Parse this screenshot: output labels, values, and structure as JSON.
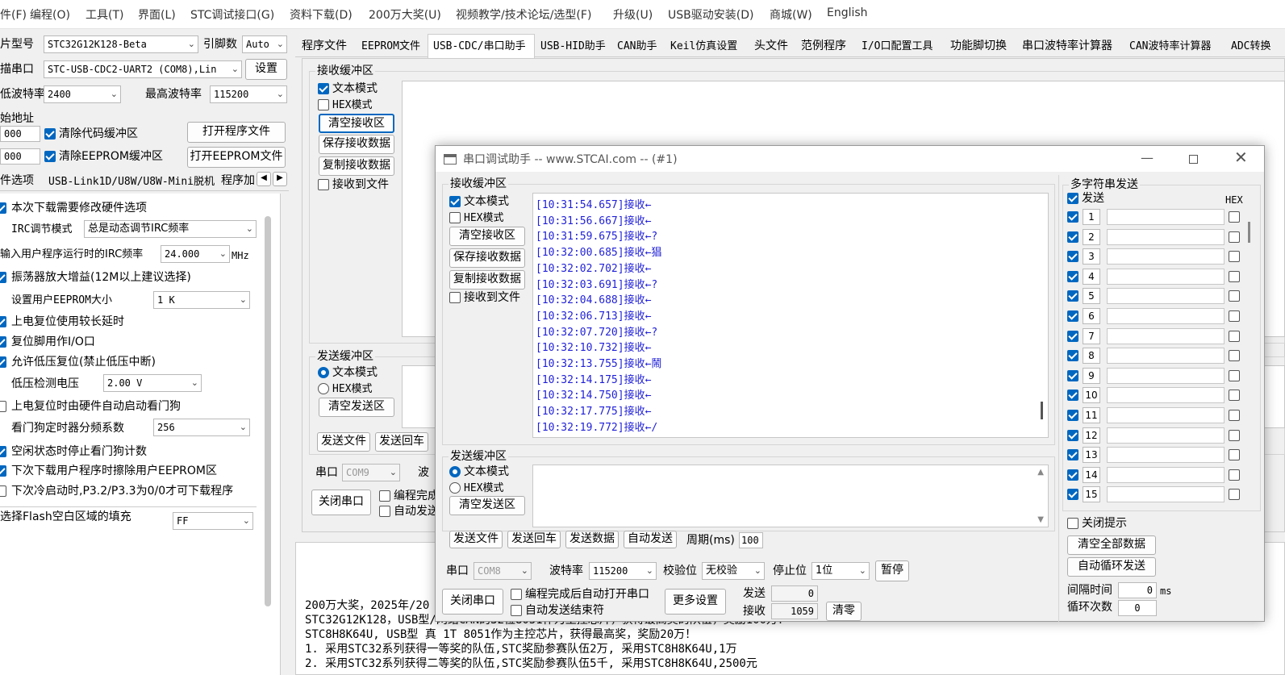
{
  "menu": [
    "件(F)",
    "编程(O)",
    "工具(T)",
    "界面(L)",
    "STC调试接口(G)",
    "资料下载(D)",
    "200万大奖(U)",
    "视频教学/技术论坛/选型(F)",
    "升级(U)",
    "USB驱动安装(D)",
    "商城(W)",
    "English"
  ],
  "left": {
    "chip_label": "片型号",
    "chip_value": "STC32G12K128-Beta",
    "pin_label": "引脚数",
    "pin_value": "Auto",
    "port_label": "描串口",
    "port_value": "STC-USB-CDC2-UART2 (COM8),Lin",
    "settings_btn": "设置",
    "min_baud_label": "低波特率",
    "min_baud_value": "2400",
    "max_baud_label": "最高波特率",
    "max_baud_value": "115200",
    "start_addr_label": "始地址",
    "addr1": "000",
    "addr2": "000",
    "clear_code": "清除代码缓冲区",
    "clear_eeprom": "清除EEPROM缓冲区",
    "open_prog": "打开程序文件",
    "open_eeprom": "打开EEPROM文件",
    "subtabs": [
      "件选项",
      "USB-Link1D/U8W/U8W-Mini脱机",
      "程序加"
    ],
    "options": [
      {
        "text": "本次下载需要修改硬件选项",
        "checked": true
      },
      {
        "text": "IRC调节模式",
        "combo": "总是动态调节IRC频率"
      },
      {
        "text": "输入用户程序运行时的IRC频率",
        "combo": "24.000",
        "unit": "MHz"
      },
      {
        "text": "振荡器放大增益(12M以上建议选择)",
        "checked": true
      },
      {
        "text": "设置用户EEPROM大小",
        "combo": "1   K"
      },
      {
        "text": "上电复位使用较长延时",
        "checked": true
      },
      {
        "text": "复位脚用作I/O口",
        "checked": true
      },
      {
        "text": "允许低压复位(禁止低压中断)",
        "checked": true
      },
      {
        "text": "低压检测电压",
        "combo": "2.00 V"
      },
      {
        "text": "上电复位时由硬件自动启动看门狗",
        "checked": false
      },
      {
        "text": "看门狗定时器分频系数",
        "combo": "256"
      },
      {
        "text": "空闲状态时停止看门狗计数",
        "checked": true
      },
      {
        "text": "下次下载用户程序时擦除用户EEPROM区",
        "checked": true
      },
      {
        "text": "下次冷启动时,P3.2/P3.3为0/0才可下载程序",
        "checked": false
      },
      {
        "text": "选择Flash空白区域的填充",
        "combo": "FF"
      }
    ]
  },
  "tabs": [
    "程序文件",
    "EEPROM文件",
    "USB-CDC/串口助手",
    "USB-HID助手",
    "CAN助手",
    "Keil仿真设置",
    "头文件",
    "范例程序",
    "I/O口配置工具",
    "功能脚切换",
    "串口波特率计算器",
    "CAN波特率计算器",
    "ADC转换"
  ],
  "bg_panel": {
    "recv_group": "接收缓冲区",
    "text_mode": "文本模式",
    "hex_mode": "HEX模式",
    "clear_recv": "清空接收区",
    "save_recv": "保存接收数据",
    "copy_recv": "复制接收数据",
    "recv_to_file": "接收到文件",
    "send_group": "发送缓冲区",
    "clear_send": "清空发送区",
    "send_file": "发送文件",
    "send_enter": "发送回车",
    "port_label": "串口",
    "port_value": "COM9",
    "baud_partial": "波",
    "close_port": "关闭串口",
    "auto_open_partial": "编程完成",
    "auto_send_partial": "自动发送"
  },
  "log": [
    "200万大奖，2025年/20",
    "STC32G12K128，USB型/网络CAN的32位8051作为主控芯片，获得最高奖的队伍，奖励100万！",
    "STC8H8K64U, USB型 真 1T 8051作为主控芯片，获得最高奖，奖励20万！",
    "1. 采用STC32系列获得一等奖的队伍,STC奖励参赛队伍2万, 采用STC8H8K64U,1万",
    "2. 采用STC32系列获得二等奖的队伍,STC奖励参赛队伍5千, 采用STC8H8K64U,2500元"
  ],
  "dialog": {
    "title": "串口调试助手 -- www.STCAI.com -- (#1)",
    "recv_group": "接收缓冲区",
    "text_mode": "文本模式",
    "hex_mode": "HEX模式",
    "clear_recv": "清空接收区",
    "save_recv": "保存接收数据",
    "copy_recv": "复制接收数据",
    "recv_to_file": "接收到文件",
    "recv_lines": [
      "[10:31:54.657]接收←",
      "[10:31:56.667]接收←",
      "[10:31:59.675]接收←?",
      "[10:32:00.685]接收←猖",
      "[10:32:02.702]接收←",
      "[10:32:03.691]接收←?",
      "[10:32:04.688]接收←",
      "[10:32:06.713]接收←",
      "[10:32:07.720]接收←?",
      "[10:32:10.732]接收←",
      "[10:32:13.755]接收←鬧",
      "[10:32:14.175]接收←",
      "[10:32:14.750]接收←",
      "[10:32:17.775]接收←",
      "[10:32:19.772]接收←/"
    ],
    "send_group": "发送缓冲区",
    "send_text_mode": "文本模式",
    "send_hex_mode": "HEX模式",
    "clear_send": "清空发送区",
    "send_file": "发送文件",
    "send_enter": "发送回车",
    "send_data": "发送数据",
    "auto_send": "自动发送",
    "period_label": "周期(ms)",
    "period_value": "100",
    "port_label": "串口",
    "port_value": "COM8",
    "baud_label": "波特率",
    "baud_value": "115200",
    "parity_label": "校验位",
    "parity_value": "无校验",
    "stop_label": "停止位",
    "stop_value": "1位",
    "pause": "暂停",
    "close_port": "关闭串口",
    "auto_open": "编程完成后自动打开串口",
    "auto_send_end": "自动发送结束符",
    "more_settings": "更多设置",
    "sent_label": "发送",
    "sent_value": "0",
    "recv_label": "接收",
    "recv_value": "1059",
    "clear_count": "清零",
    "multi_group": "多字符串发送",
    "multi_send": "发送",
    "multi_hex": "HEX",
    "rows": [
      "1",
      "2",
      "3",
      "4",
      "5",
      "6",
      "7",
      "8",
      "9",
      "10",
      "11",
      "12",
      "13",
      "14",
      "15"
    ],
    "close_hint": "关闭提示",
    "clear_all": "清空全部数据",
    "auto_loop": "自动循环发送",
    "interval_label": "间隔时间",
    "interval_value": "0",
    "interval_unit": "ms",
    "loop_label": "循环次数",
    "loop_value": "0"
  }
}
